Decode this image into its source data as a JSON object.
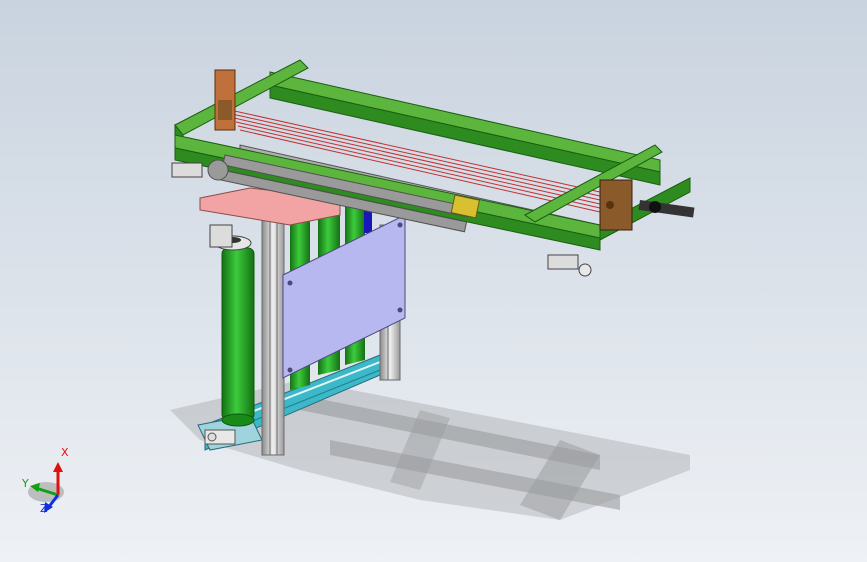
{
  "viewport": {
    "background_top": "#c9d3df",
    "background_bottom": "#eef1f5"
  },
  "colors": {
    "frame_green": "#2e8b1f",
    "frame_green_dark": "#1b5e12",
    "frame_green_light": "#5cb63e",
    "cylinder_green": "#21a021",
    "cylinder_dark": "#147014",
    "plate_lavender": "#b8b8f0",
    "plate_pink": "#f2a4a4",
    "aluminum": "#c8c8c8",
    "aluminum_dark": "#8a8a8a",
    "base_cyan": "#3cb8c8",
    "bracket_brown": "#8a5a2a",
    "bracket_orange": "#c0703a",
    "chain_gray": "#9a9a9a",
    "chain_dark": "#505050",
    "red_rods": "#c23030",
    "shadow": "#5a5a5a",
    "axis_x": "#e01010",
    "axis_y": "#10a010",
    "axis_z": "#1030e0"
  },
  "triad": {
    "x_label": "X",
    "y_label": "Y",
    "z_label": "Z"
  }
}
